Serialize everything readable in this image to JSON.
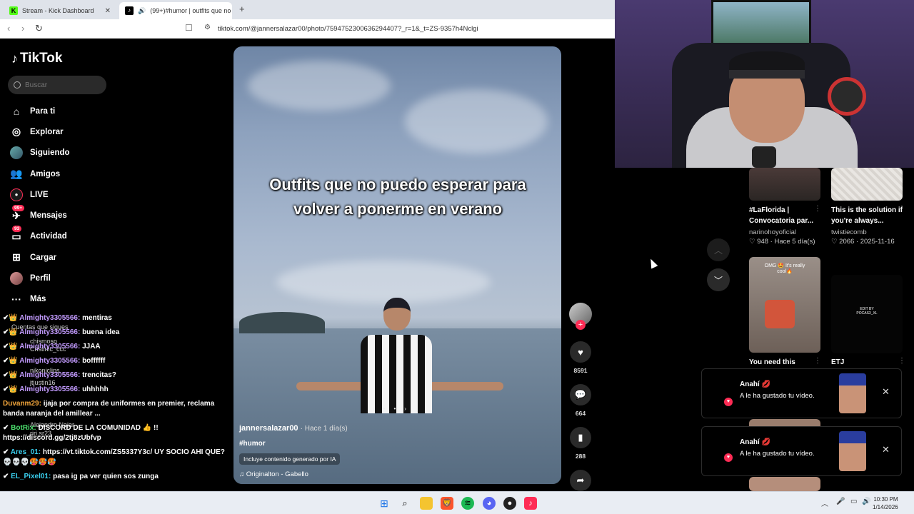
{
  "browser": {
    "tabs": [
      {
        "title": "Stream - Kick Dashboard",
        "favicon": "kick-icon"
      },
      {
        "title": "(99+)#humor | outfits que no",
        "favicon": "tiktok-icon",
        "active": true
      }
    ],
    "new_tab": "+",
    "url": "tiktok.com/@jannersalazar00/photo/7594752300636294407?_r=1&_t=ZS-9357h4Nclgi"
  },
  "tiktok": {
    "logo": "TikTok",
    "search_placeholder": "Buscar",
    "nav": [
      {
        "label": "Para ti",
        "icon": "home-icon"
      },
      {
        "label": "Explorar",
        "icon": "compass-icon"
      },
      {
        "label": "Siguiendo",
        "icon": "following-avatar-icon"
      },
      {
        "label": "Amigos",
        "icon": "friends-icon"
      },
      {
        "label": "LIVE",
        "icon": "live-icon"
      },
      {
        "label": "Mensajes",
        "icon": "messages-icon",
        "badge": "99+"
      },
      {
        "label": "Actividad",
        "icon": "activity-icon",
        "badge": "93"
      },
      {
        "label": "Cargar",
        "icon": "upload-icon"
      },
      {
        "label": "Perfil",
        "icon": "profile-avatar-icon"
      },
      {
        "label": "Más",
        "icon": "more-icon"
      }
    ],
    "following_header": "Cuentas que sigues",
    "following_ghosts": [
      "chismoso",
      "Cristinic_ccc",
      "nikoniclips",
      "jtjustin16",
      "Alejandro Najar",
      "riri.sr23"
    ]
  },
  "chat": [
    {
      "user": "Almighty3305566:",
      "text": "mentiras",
      "color": "purple"
    },
    {
      "user": "Almighty3305566:",
      "text": "buena idea",
      "color": "purple"
    },
    {
      "user": "Almighty3305566:",
      "text": "JJAA",
      "color": "purple"
    },
    {
      "user": "Almighty3305566:",
      "text": "boffffff",
      "color": "purple"
    },
    {
      "user": "Almighty3305566:",
      "text": "trencitas?",
      "color": "purple"
    },
    {
      "user": "Almighty3305566:",
      "text": "uhhhhh",
      "color": "purple"
    },
    {
      "user": "Duvanm29:",
      "text": "ijaja por compra de uniformes en premier, reclama banda naranja del amillear ...",
      "color": "orange"
    },
    {
      "user": "BotRix:",
      "text": "DISCORD DE LA COMUNIDAD 👍 !! https://discord.gg/2tj8zUbfvp",
      "color": "green"
    },
    {
      "user": "Ares_01:",
      "text": "https://vt.tiktok.com/ZS5337Y3c/ UY SOCIO AHI QUE? 💀💀💀🥵🥵🥵",
      "color": "cyan"
    },
    {
      "user": "EL_Pixel01:",
      "text": "pasa ig pa ver quien sos zunga",
      "color": "cyan"
    }
  ],
  "video": {
    "caption": "Outfits que no puedo  esperar para volver a ponerme en verano",
    "author": "jannersalazar00",
    "time": "· Hace 1 día(s)",
    "hashtag": "#humor",
    "ai_label": "Incluye contenido generado por IA",
    "music": "Originalton - Gabello",
    "carousel_prev": "‹",
    "carousel_next": "›"
  },
  "actions": {
    "likes": "8591",
    "comments": "664",
    "saves": "288",
    "shares": "4439"
  },
  "grid": [
    {
      "title": "#LaFlorida | Convocatoria par...",
      "author": "narinohoyoficial",
      "likes": "948",
      "date": "Hace 5 día(s)"
    },
    {
      "title": "This is the solution if you're always...",
      "author": "twistiecomb",
      "likes": "2066",
      "date": "2025-11-16"
    },
    {
      "title": "You need this",
      "thumb_text": "OMG 🤩 It's really cool🔥"
    },
    {
      "title": "ETJ",
      "thumb_text": "EDIT BY POCAS3_XL"
    }
  ],
  "notifications": [
    {
      "user": "Anahí 💋",
      "text": "A le ha gustado tu vídeo."
    },
    {
      "user": "Anahí 💋",
      "text": "A le ha gustado tu vídeo."
    }
  ],
  "taskbar": {
    "time": "10:30 PM",
    "date": "1/14/2026"
  },
  "colors": {
    "tiktok_red": "#fe2c55",
    "chat_purple": "#c39bff",
    "chat_orange": "#f2a53b",
    "chat_green": "#4ce06d",
    "chat_cyan": "#3ad0f0"
  }
}
